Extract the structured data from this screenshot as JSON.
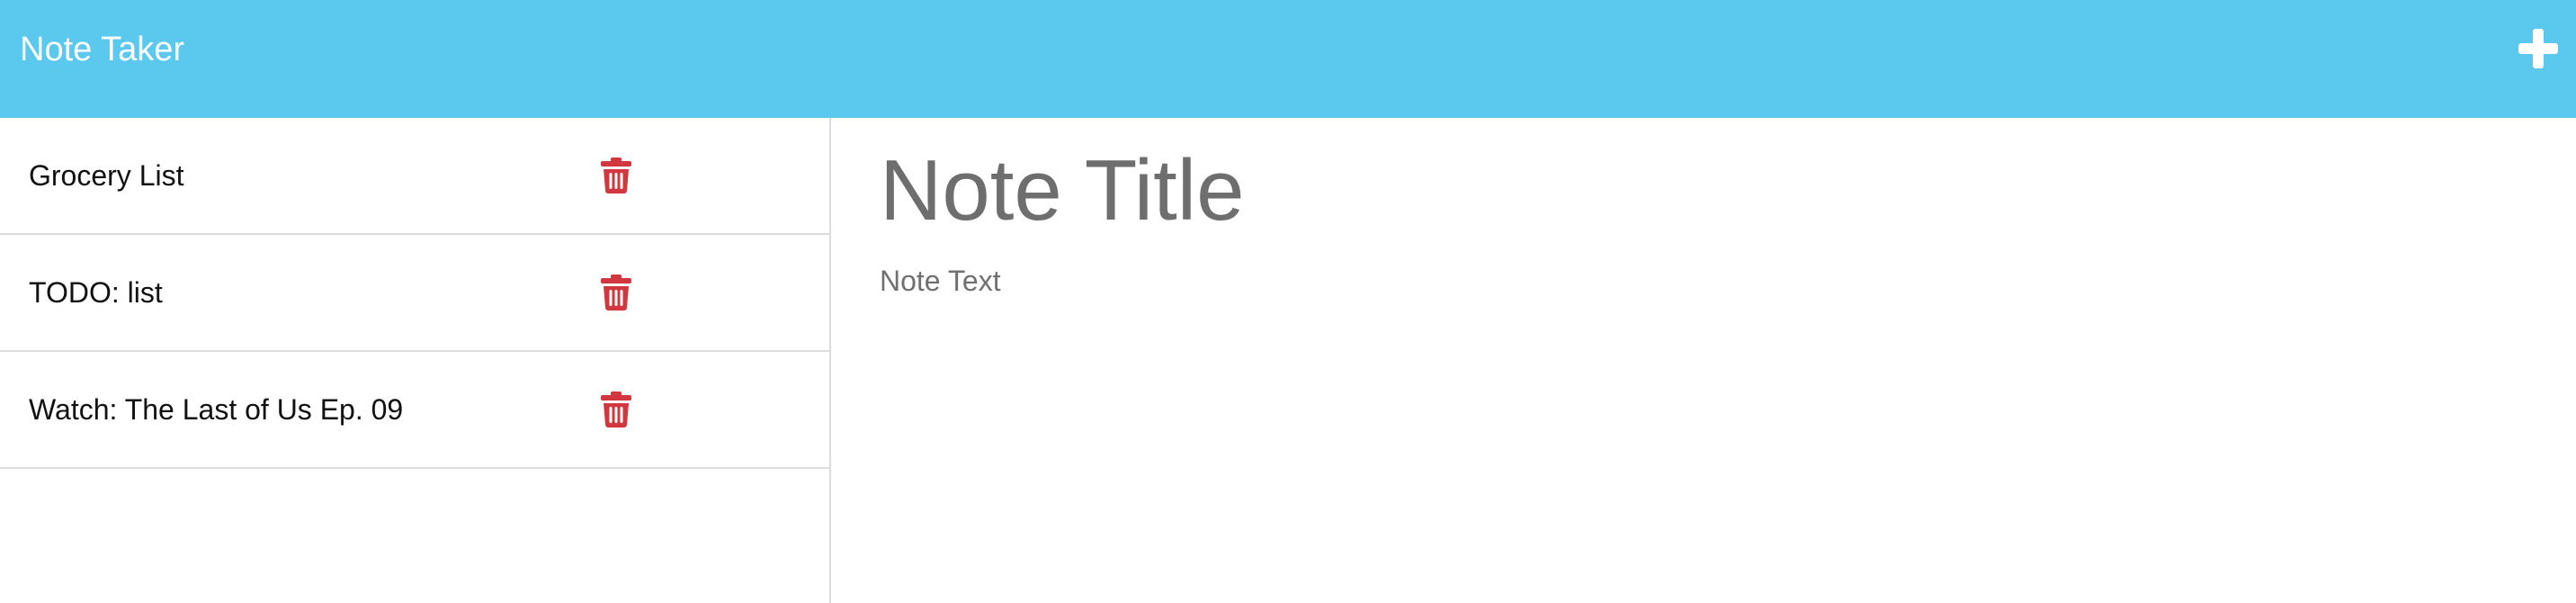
{
  "app": {
    "title": "Note Taker",
    "accent_color": "#5bc8ee",
    "new_note_icon": "plus-icon"
  },
  "notes": [
    {
      "title": "Grocery List",
      "delete_icon": "trash-icon"
    },
    {
      "title": "TODO: list",
      "delete_icon": "trash-icon"
    },
    {
      "title": "Watch: The Last of Us Ep. 09",
      "delete_icon": "trash-icon"
    }
  ],
  "editor": {
    "title_placeholder": "Note Title",
    "text_placeholder": "Note Text"
  },
  "colors": {
    "delete": "#d2373f",
    "divider": "#dcdcdc"
  }
}
